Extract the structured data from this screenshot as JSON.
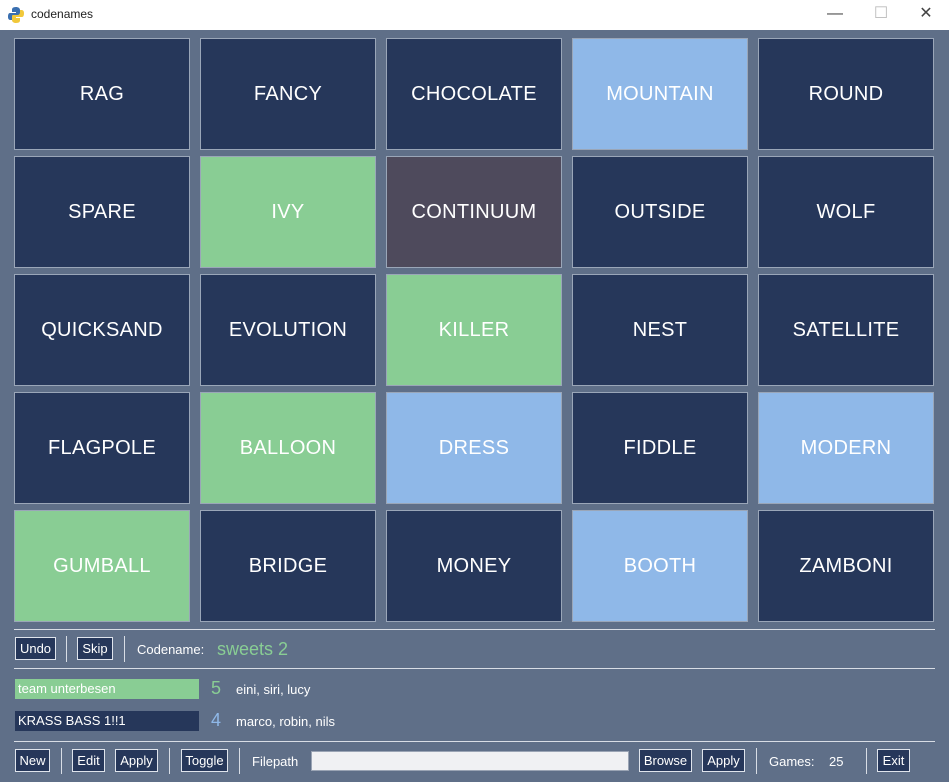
{
  "window": {
    "title": "codenames",
    "min": "—",
    "max": "☐",
    "close": "✕"
  },
  "colors": {
    "neutral": "#26375a",
    "green": "#89cd94",
    "blue": "#8fb8e8",
    "assassin": "#4e4a5c"
  },
  "cards": [
    {
      "word": "RAG",
      "type": "neutral"
    },
    {
      "word": "FANCY",
      "type": "neutral"
    },
    {
      "word": "CHOCOLATE",
      "type": "neutral"
    },
    {
      "word": "MOUNTAIN",
      "type": "blue"
    },
    {
      "word": "ROUND",
      "type": "neutral"
    },
    {
      "word": "SPARE",
      "type": "neutral"
    },
    {
      "word": "IVY",
      "type": "green"
    },
    {
      "word": "CONTINUUM",
      "type": "assassin"
    },
    {
      "word": "OUTSIDE",
      "type": "neutral"
    },
    {
      "word": "WOLF",
      "type": "neutral"
    },
    {
      "word": "QUICKSAND",
      "type": "neutral"
    },
    {
      "word": "EVOLUTION",
      "type": "neutral"
    },
    {
      "word": "KILLER",
      "type": "green"
    },
    {
      "word": "NEST",
      "type": "neutral"
    },
    {
      "word": "SATELLITE",
      "type": "neutral"
    },
    {
      "word": "FLAGPOLE",
      "type": "neutral"
    },
    {
      "word": "BALLOON",
      "type": "green"
    },
    {
      "word": "DRESS",
      "type": "blue"
    },
    {
      "word": "FIDDLE",
      "type": "neutral"
    },
    {
      "word": "MODERN",
      "type": "blue"
    },
    {
      "word": "GUMBALL",
      "type": "green"
    },
    {
      "word": "BRIDGE",
      "type": "neutral"
    },
    {
      "word": "MONEY",
      "type": "neutral"
    },
    {
      "word": "BOOTH",
      "type": "blue"
    },
    {
      "word": "ZAMBONI",
      "type": "neutral"
    }
  ],
  "controls": {
    "undo": "Undo",
    "skip": "Skip",
    "codename_label": "Codename:",
    "codename_value": "sweets 2"
  },
  "teams": [
    {
      "name": "team unterbesen",
      "score": "5",
      "members": "eini, siri, lucy",
      "color": "#89cd94"
    },
    {
      "name": "KRASS BASS 1!!1",
      "score": "4",
      "members": "marco, robin, nils",
      "color": "#8fb8e8"
    }
  ],
  "footer": {
    "new": "New",
    "edit": "Edit",
    "apply1": "Apply",
    "toggle": "Toggle",
    "filepath_label": "Filepath",
    "filepath_value": "",
    "browse": "Browse",
    "apply2": "Apply",
    "games_label": "Games:",
    "games_value": "25",
    "exit": "Exit"
  }
}
